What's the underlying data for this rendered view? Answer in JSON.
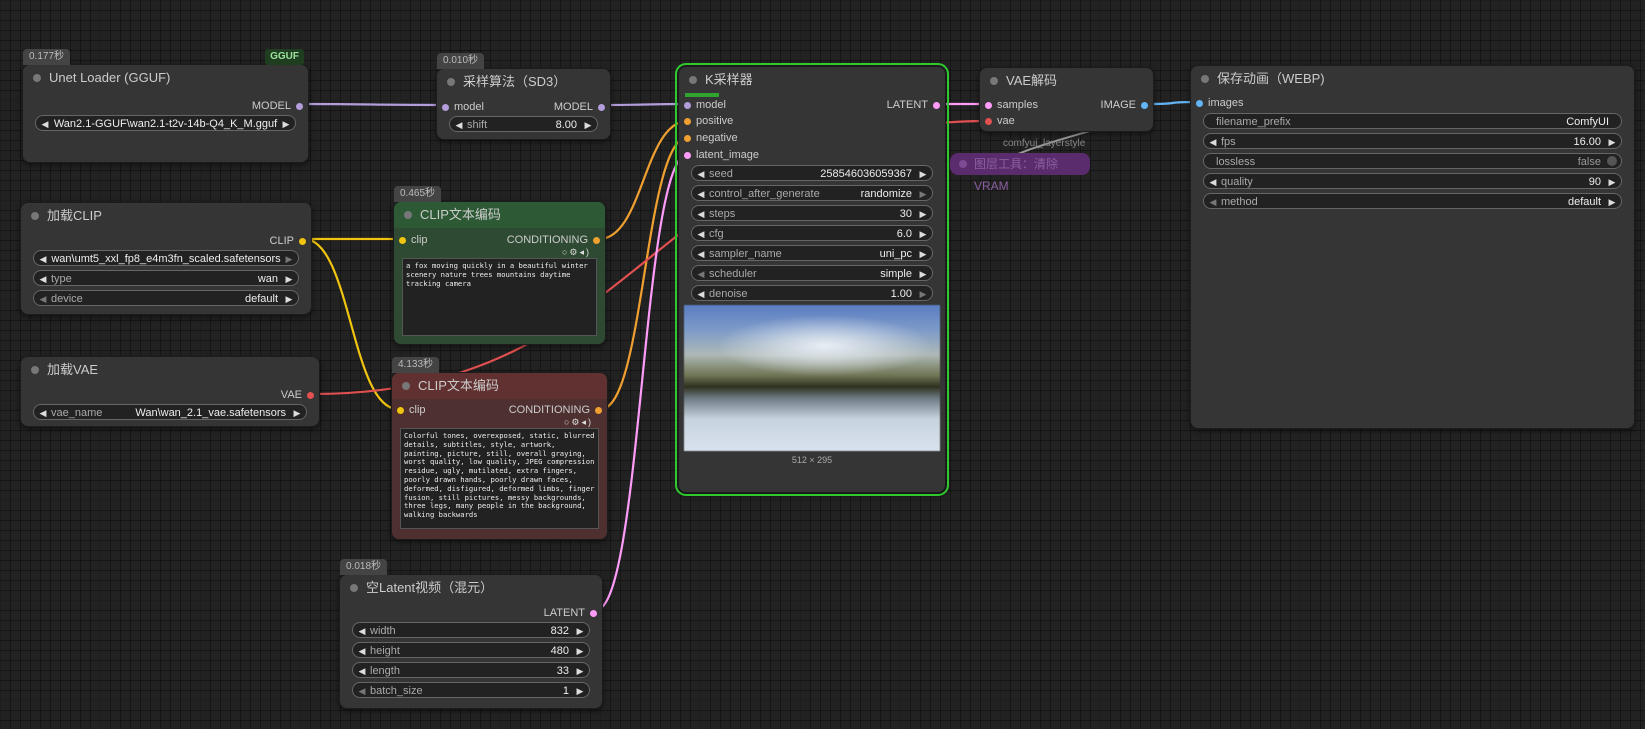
{
  "colors": {
    "model": "#b39ddb",
    "clip": "#f1c40f",
    "conditioning": "#f0a030",
    "vae": "#e05050",
    "latent": "#ff9cf9",
    "image": "#64b5f6",
    "selected_outline": "#2fc92f"
  },
  "unet_loader": {
    "time": "0.177秒",
    "badge": "GGUF",
    "title": "Unet Loader (GGUF)",
    "out_model": "MODEL",
    "unet_name": "Wan2.1-GGUF\\wan2.1-t2v-14b-Q4_K_M.gguf"
  },
  "sampling_sd3": {
    "time": "0.010秒",
    "title": "采样算法（SD3）",
    "in_model": "model",
    "out_model": "MODEL",
    "shift_label": "shift",
    "shift_value": "8.00"
  },
  "load_clip": {
    "title": "加载CLIP",
    "out_clip": "CLIP",
    "clip_name": "wan\\umt5_xxl_fp8_e4m3fn_scaled.safetensors",
    "type_label": "type",
    "type_value": "wan",
    "device_label": "device",
    "device_value": "default"
  },
  "clip_positive": {
    "time": "0.465秒",
    "title": "CLIP文本编码",
    "in_clip": "clip",
    "out_conditioning": "CONDITIONING",
    "text": "a fox moving quickly in a beautiful winter scenery nature trees mountains daytime tracking camera"
  },
  "load_vae": {
    "title": "加载VAE",
    "out_vae": "VAE",
    "vae_name_label": "vae_name",
    "vae_name_value": "Wan\\wan_2.1_vae.safetensors"
  },
  "clip_negative": {
    "time": "4.133秒",
    "title": "CLIP文本编码",
    "in_clip": "clip",
    "out_conditioning": "CONDITIONING",
    "text": "Colorful tones, overexposed, static, blurred details, subtitles, style, artwork, painting, picture, still, overall graying, worst quality, low quality, JPEG compression residue, ugly, mutilated, extra fingers, poorly drawn hands, poorly drawn faces, deformed, disfigured, deformed limbs, finger fusion, still pictures, messy backgrounds, three legs, many people in the background, walking backwards"
  },
  "ksampler": {
    "title": "K采样器",
    "in_model": "model",
    "in_positive": "positive",
    "in_negative": "negative",
    "in_latent": "latent_image",
    "out_latent": "LATENT",
    "widgets": [
      {
        "name": "seed",
        "value": "258546036059367"
      },
      {
        "name": "control_after_generate",
        "value": "randomize"
      },
      {
        "name": "steps",
        "value": "30"
      },
      {
        "name": "cfg",
        "value": "6.0"
      },
      {
        "name": "sampler_name",
        "value": "uni_pc"
      },
      {
        "name": "scheduler",
        "value": "simple"
      },
      {
        "name": "denoise",
        "value": "1.00"
      }
    ],
    "preview_size": "512 × 295"
  },
  "vae_decode": {
    "title": "VAE解码",
    "in_samples": "samples",
    "in_vae": "vae",
    "out_image": "IMAGE"
  },
  "layerstyle": {
    "label": "comfyui_layerstyle",
    "chip": "图层工具：清除VRAM"
  },
  "save_webp": {
    "title": "保存动画（WEBP)",
    "in_images": "images",
    "widgets": [
      {
        "name": "filename_prefix",
        "value": "ComfyUI"
      },
      {
        "name": "fps",
        "value": "16.00"
      },
      {
        "name": "lossless",
        "value": "false"
      },
      {
        "name": "quality",
        "value": "90"
      },
      {
        "name": "method",
        "value": "default"
      }
    ]
  },
  "empty_latent": {
    "time": "0.018秒",
    "title": "空Latent视频（混元）",
    "out_latent": "LATENT",
    "widgets": [
      {
        "name": "width",
        "value": "832"
      },
      {
        "name": "height",
        "value": "480"
      },
      {
        "name": "length",
        "value": "33"
      },
      {
        "name": "batch_size",
        "value": "1"
      }
    ]
  }
}
